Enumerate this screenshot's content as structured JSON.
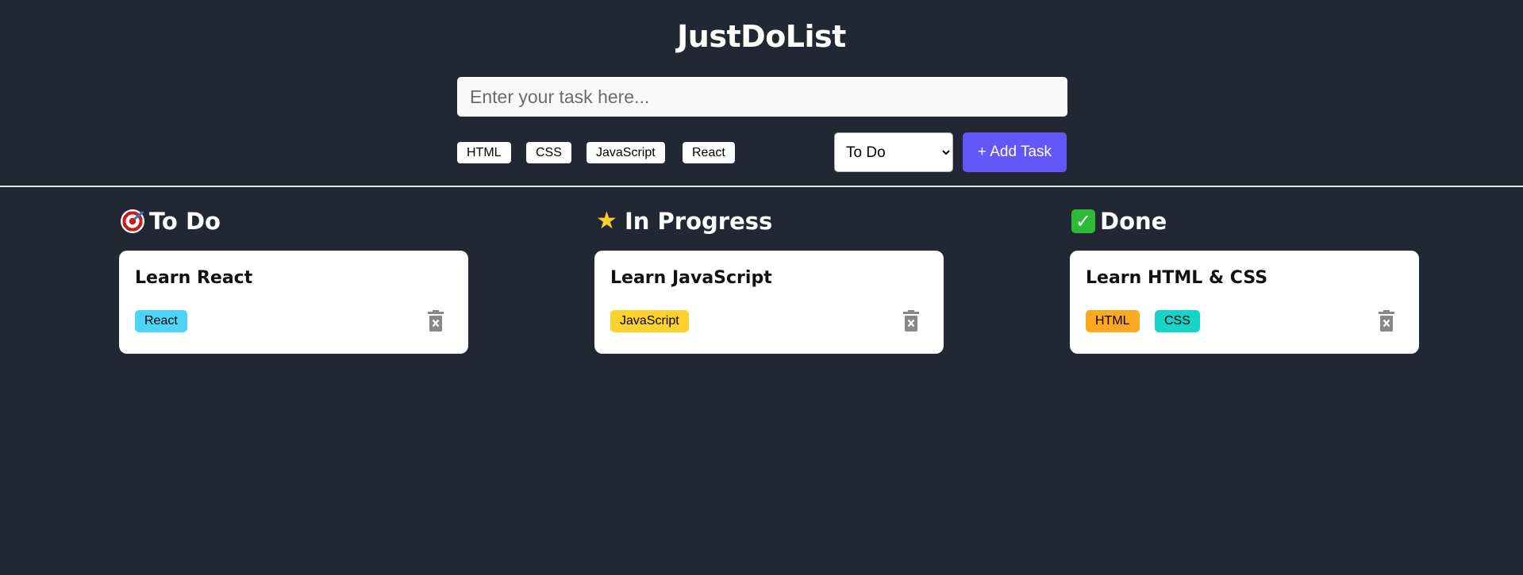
{
  "app": {
    "title": "JustDoList"
  },
  "form": {
    "input_placeholder": "Enter your task here...",
    "input_value": "",
    "tags": [
      "HTML",
      "CSS",
      "JavaScript",
      "React"
    ],
    "status_selected": "To Do",
    "add_button_label": "+ Add Task"
  },
  "columns": [
    {
      "heading": "To Do",
      "icon": "target-icon",
      "tasks": [
        {
          "title": "Learn React",
          "tags": [
            {
              "label": "React",
              "color": "#4dd5f7"
            }
          ]
        }
      ]
    },
    {
      "heading": "In Progress",
      "icon": "star-icon",
      "tasks": [
        {
          "title": "Learn JavaScript",
          "tags": [
            {
              "label": "JavaScript",
              "color": "#fed22e"
            }
          ]
        }
      ]
    },
    {
      "heading": "Done",
      "icon": "check-icon",
      "tasks": [
        {
          "title": "Learn HTML & CSS",
          "tags": [
            {
              "label": "HTML",
              "color": "#fda821"
            },
            {
              "label": "CSS",
              "color": "#15d4c8"
            }
          ]
        }
      ]
    }
  ],
  "colors": {
    "background": "#222833",
    "accent": "#6457f9",
    "card": "#ffffff",
    "delete_icon": "#888888"
  }
}
